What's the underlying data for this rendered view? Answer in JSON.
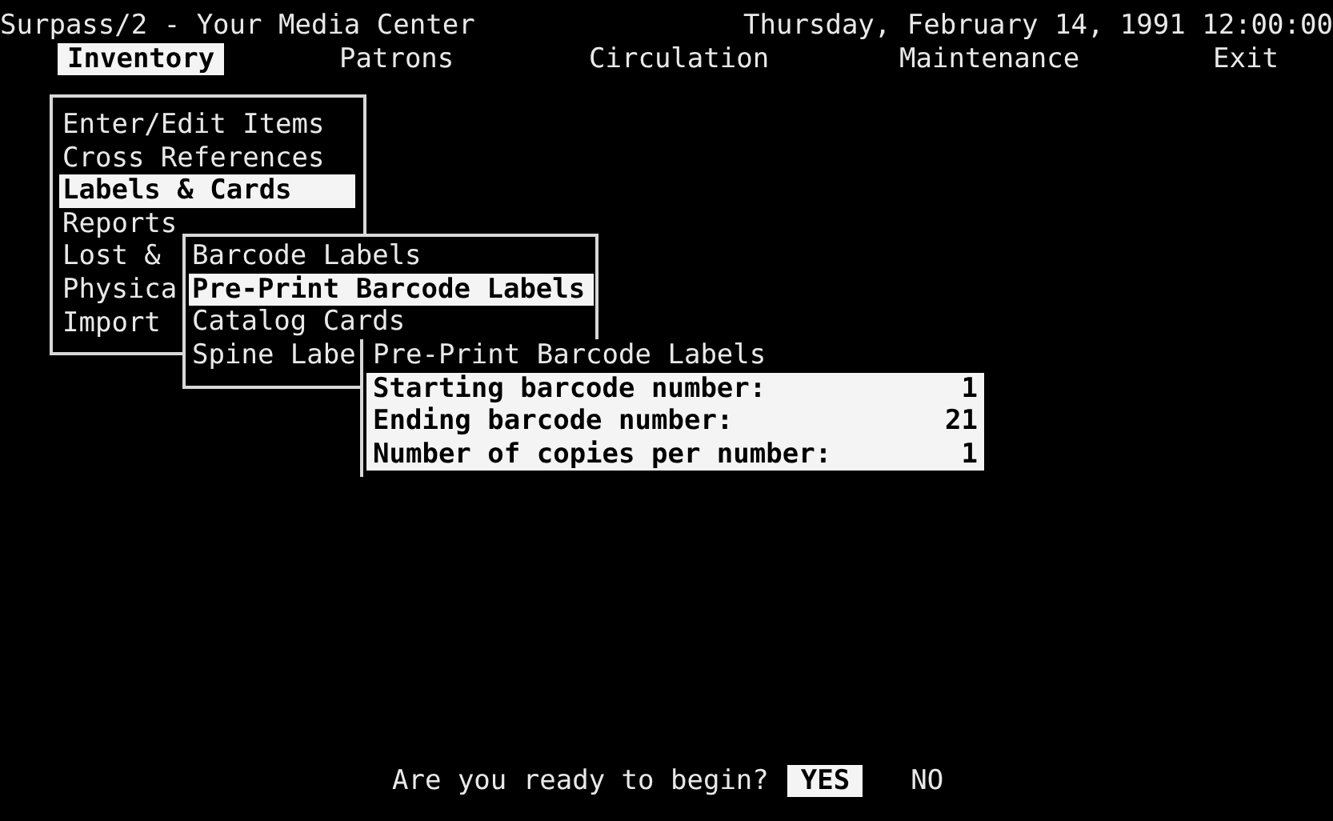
{
  "title": "Surpass/2 - Your Media Center",
  "datetime": "Thursday, February 14, 1991 12:00:00",
  "menu_bar": [
    {
      "label": "Inventory",
      "selected": true
    },
    {
      "label": "Patrons",
      "selected": false
    },
    {
      "label": "Circulation",
      "selected": false
    },
    {
      "label": "Maintenance",
      "selected": false
    },
    {
      "label": "Exit",
      "selected": false
    }
  ],
  "inventory_menu": {
    "items": [
      {
        "label": "Enter/Edit Items",
        "selected": false
      },
      {
        "label": "Cross References",
        "selected": false
      },
      {
        "label": "Labels & Cards",
        "selected": true
      },
      {
        "label": "Reports",
        "selected": false
      },
      {
        "label": "Lost &",
        "selected": false
      },
      {
        "label": "Physica",
        "selected": false
      },
      {
        "label": "Import",
        "selected": false
      }
    ]
  },
  "labels_submenu": {
    "items": [
      {
        "label": "Barcode Labels",
        "selected": false
      },
      {
        "label": "Pre-Print Barcode Labels",
        "selected": true
      },
      {
        "label": "Catalog Cards",
        "selected": false
      },
      {
        "label": "Spine Labe",
        "selected": false
      }
    ]
  },
  "dialog": {
    "title": "Pre-Print Barcode Labels",
    "fields": [
      {
        "label": "Starting barcode number:",
        "value": "1"
      },
      {
        "label": "Ending barcode number:",
        "value": "21"
      },
      {
        "label": "Number of copies per number:",
        "value": "1"
      }
    ]
  },
  "prompt": {
    "question": "Are you ready to begin?",
    "buttons": [
      {
        "label": "YES",
        "selected": true
      },
      {
        "label": "NO",
        "selected": false
      }
    ]
  }
}
